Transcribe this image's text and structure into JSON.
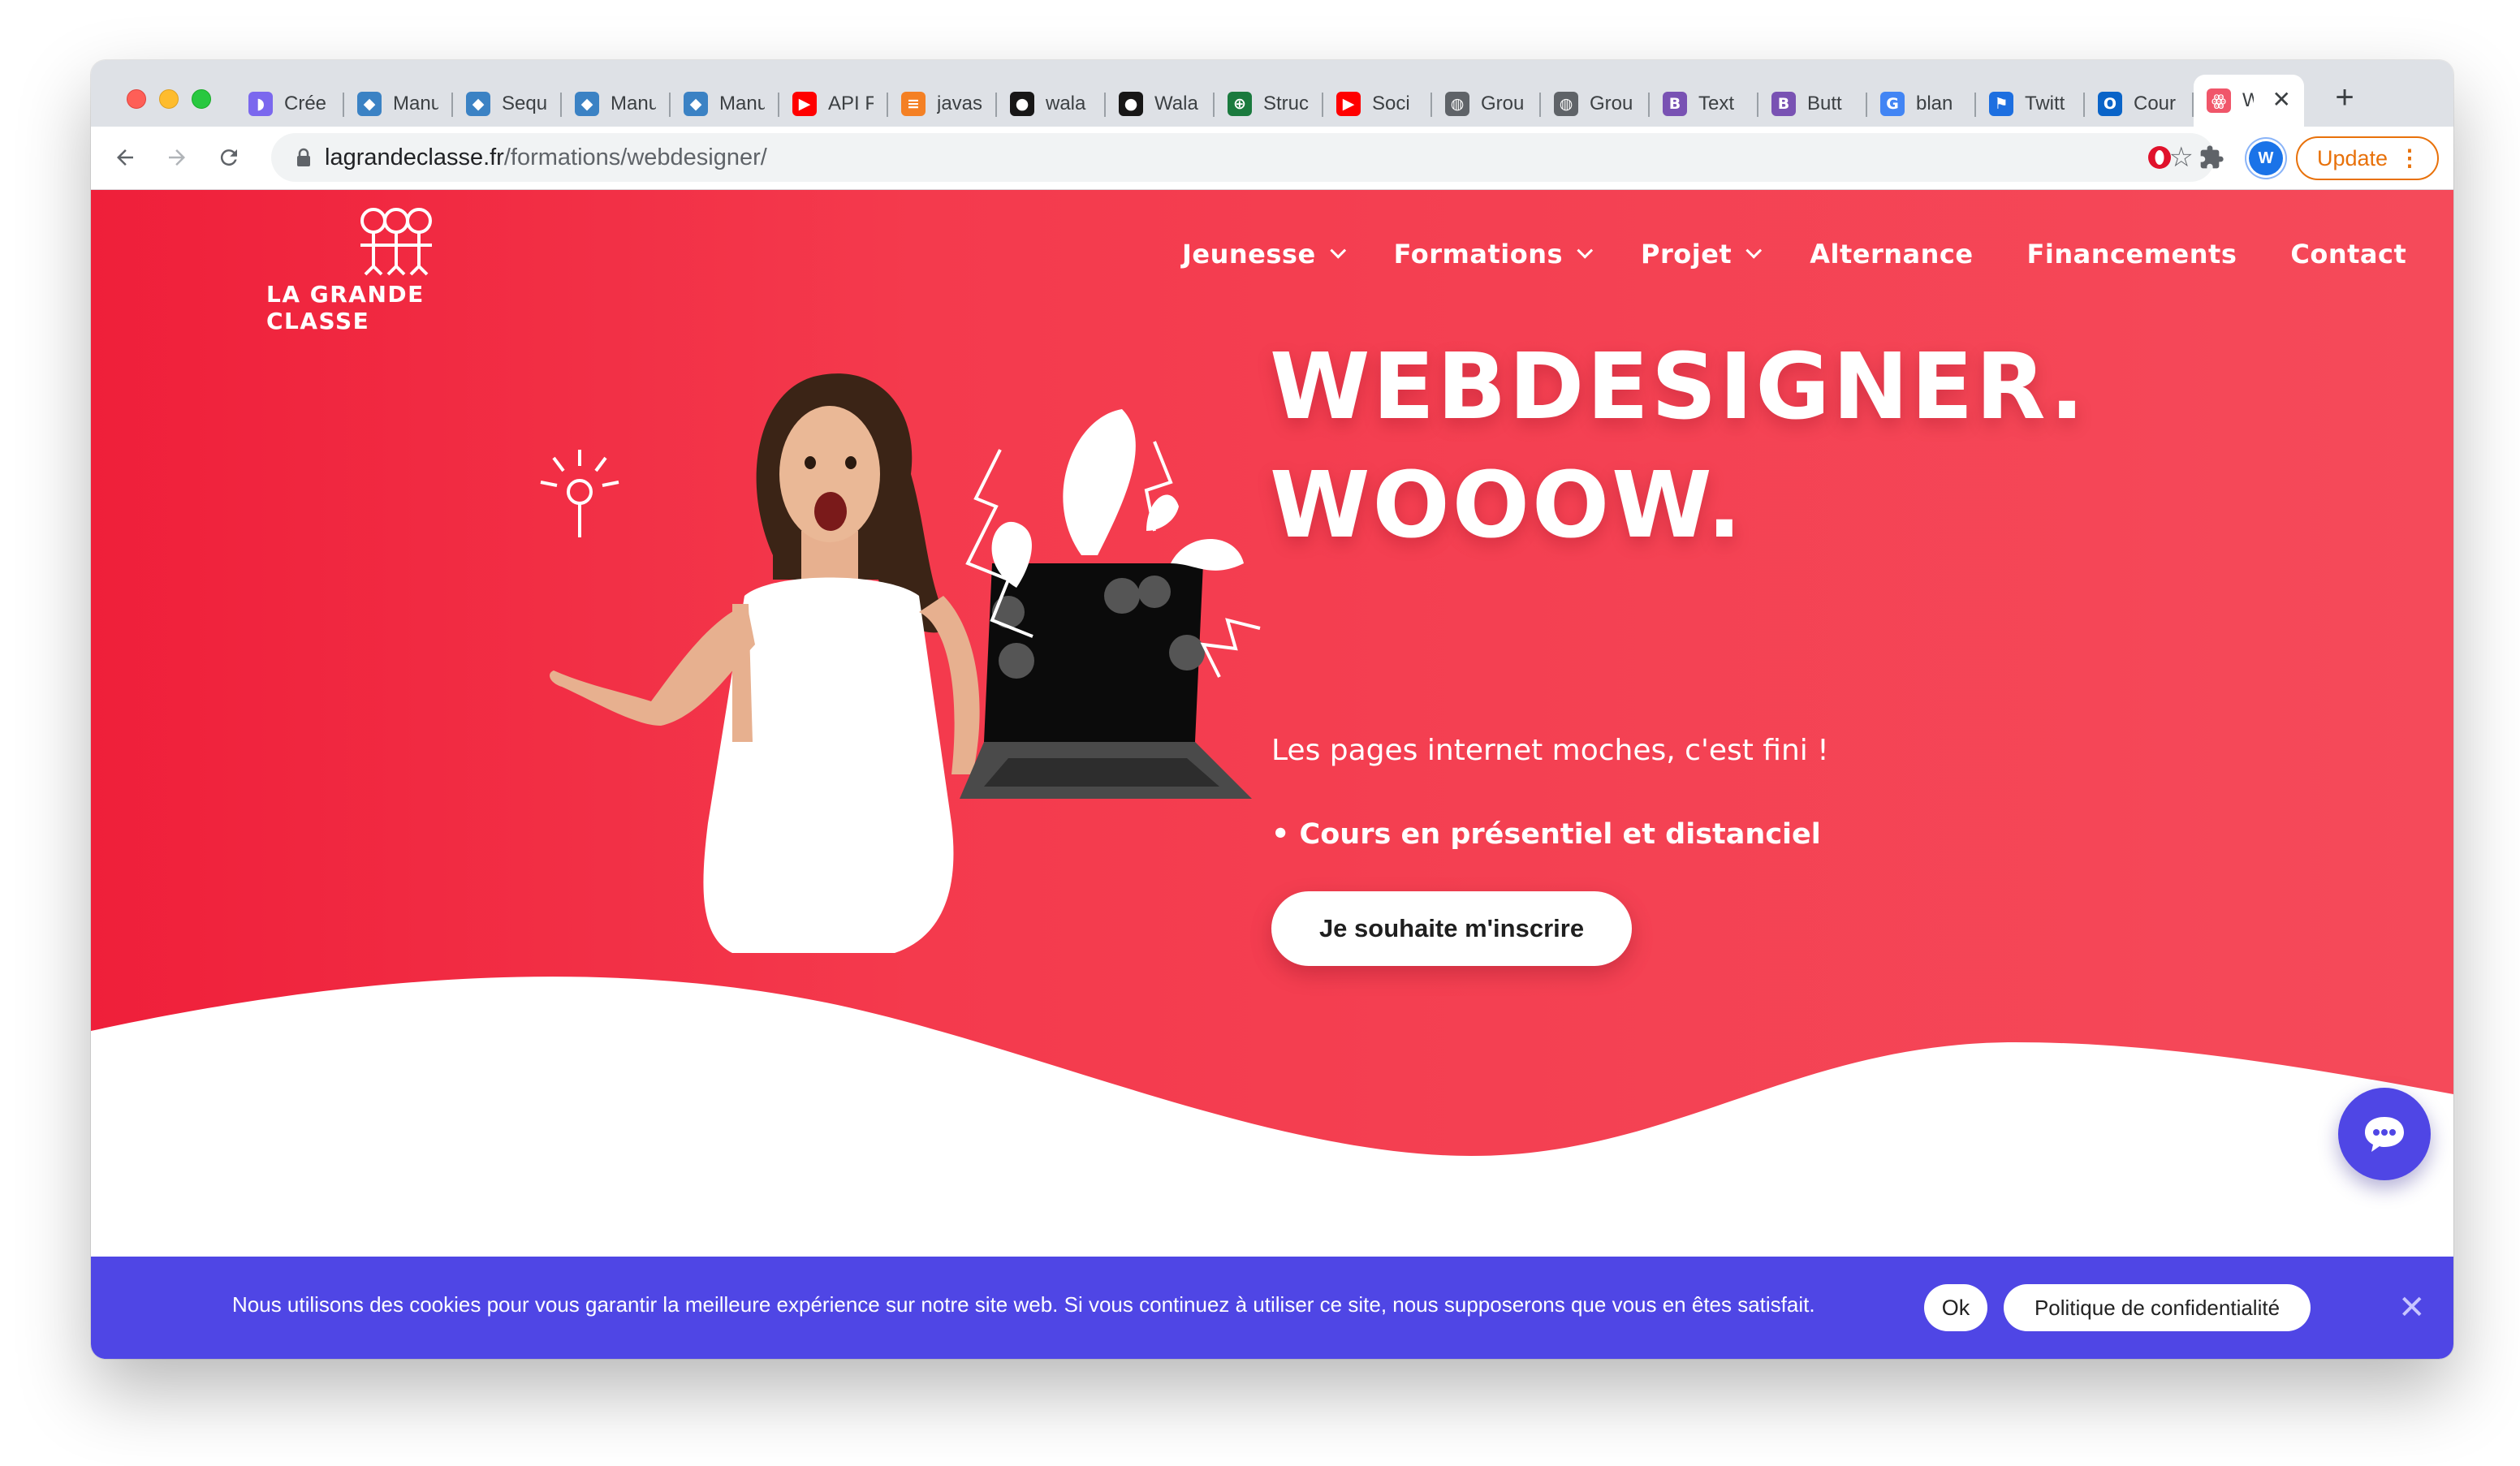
{
  "browser": {
    "tabs": [
      {
        "label": "Crée",
        "icon": "clickup-icon",
        "color": "#7b68ee",
        "glyph": "◗"
      },
      {
        "label": "Manu",
        "icon": "cube-icon",
        "color": "#3b82c4",
        "glyph": "◆"
      },
      {
        "label": "Sequ",
        "icon": "cube-icon",
        "color": "#3b82c4",
        "glyph": "◆"
      },
      {
        "label": "Manu",
        "icon": "cube-icon",
        "color": "#3b82c4",
        "glyph": "◆"
      },
      {
        "label": "Manu",
        "icon": "cube-icon",
        "color": "#3b82c4",
        "glyph": "◆"
      },
      {
        "label": "API F",
        "icon": "youtube-icon",
        "color": "#ff0000",
        "glyph": "▶"
      },
      {
        "label": "javas",
        "icon": "stackoverflow-icon",
        "color": "#f48024",
        "glyph": "≡"
      },
      {
        "label": "wala",
        "icon": "github-icon",
        "color": "#181717",
        "glyph": "●"
      },
      {
        "label": "Wala",
        "icon": "github-icon",
        "color": "#181717",
        "glyph": "●"
      },
      {
        "label": "Struc",
        "icon": "globe-green-icon",
        "color": "#1b7a3e",
        "glyph": "⊕"
      },
      {
        "label": "Soci",
        "icon": "youtube-icon",
        "color": "#ff0000",
        "glyph": "▶"
      },
      {
        "label": "Grou",
        "icon": "globe-icon",
        "color": "#5f6368",
        "glyph": "◍"
      },
      {
        "label": "Grou",
        "icon": "globe-icon",
        "color": "#5f6368",
        "glyph": "◍"
      },
      {
        "label": "Text",
        "icon": "bootstrap-icon",
        "color": "#7952b3",
        "glyph": "B"
      },
      {
        "label": "Butt",
        "icon": "bootstrap-icon",
        "color": "#7952b3",
        "glyph": "B"
      },
      {
        "label": "blan",
        "icon": "google-icon",
        "color": "#4285f4",
        "glyph": "G"
      },
      {
        "label": "Twitt",
        "icon": "flag-icon",
        "color": "#1d6fe0",
        "glyph": "⚑"
      },
      {
        "label": "Cour",
        "icon": "outlook-icon",
        "color": "#0a64c8",
        "glyph": "O"
      },
      {
        "label": "W",
        "icon": "lagrandeclasse-icon",
        "color": "#f0566a",
        "glyph": "ꙮ",
        "active": true
      }
    ],
    "url_host": "lagrandeclasse.fr",
    "url_path": "/formations/webdesigner/",
    "profile_initial": "W",
    "update_label": "Update"
  },
  "site": {
    "logo_text": "LA GRANDE CLASSE",
    "nav": [
      {
        "label": "Jeunesse",
        "dropdown": true
      },
      {
        "label": "Formations",
        "dropdown": true
      },
      {
        "label": "Projet",
        "dropdown": true
      },
      {
        "label": "Alternance",
        "dropdown": false
      },
      {
        "label": "Financements",
        "dropdown": false
      },
      {
        "label": "Contact",
        "dropdown": false
      }
    ],
    "headline_line1": "WEBDESIGNER.",
    "headline_line2": "WOOOW.",
    "subtitle": "Les pages internet moches, c'est fini !",
    "bullet": "• Cours en présentiel et distanciel",
    "cta_label": "Je souhaite m'inscrire",
    "colors": {
      "brand": "#f4404f",
      "brand_dark": "#ef1f3a",
      "cookie_bar": "#4f46e5"
    }
  },
  "cookie": {
    "text": "Nous utilisons des cookies pour vous garantir la meilleure expérience sur notre site web. Si vous continuez à utiliser ce site, nous supposerons que vous en êtes satisfait.",
    "ok_label": "Ok",
    "policy_label": "Politique de confidentialité",
    "close_glyph": "✕"
  }
}
